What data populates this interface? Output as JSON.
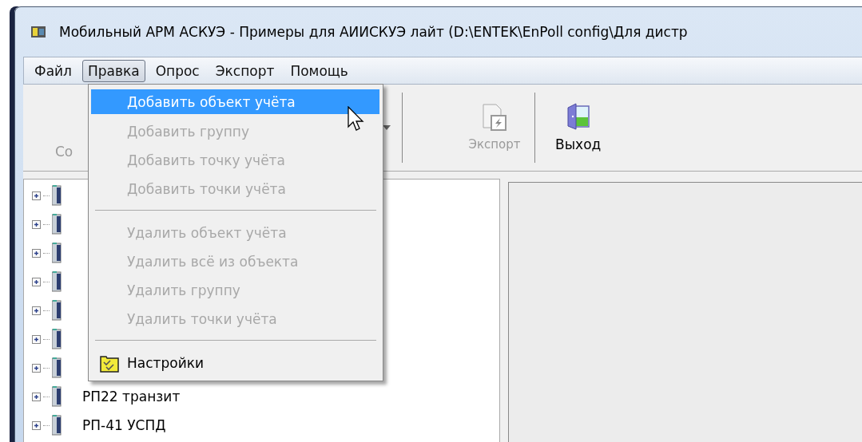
{
  "window": {
    "title": "Мобильный АРМ АСКУЭ - Примеры для АИИСКУЭ лайт (D:\\ENTEK\\EnPoll config\\Для дистр"
  },
  "menu_bar": [
    {
      "label": "Файл",
      "selected": false
    },
    {
      "label": "Правка",
      "selected": true
    },
    {
      "label": "Опрос",
      "selected": false
    },
    {
      "label": "Экспорт",
      "selected": false
    },
    {
      "label": "Помощь",
      "selected": false
    }
  ],
  "toolbar": [
    {
      "kind": "partial",
      "label": "Со",
      "disabled": true
    },
    {
      "kind": "dropdown"
    },
    {
      "kind": "separator"
    },
    {
      "kind": "export",
      "label": "Экспорт",
      "disabled": true
    },
    {
      "kind": "separator"
    },
    {
      "kind": "exit",
      "label": "Выход",
      "disabled": false
    }
  ],
  "tree": {
    "items": [
      {
        "expanded": false
      },
      {
        "expanded": false
      },
      {
        "expanded": false
      },
      {
        "expanded": false
      },
      {
        "expanded": false
      },
      {
        "expanded": false
      },
      {
        "expanded": false
      },
      {
        "label": "РП22 транзит",
        "expanded": false
      },
      {
        "label": "РП-41 УСПД",
        "expanded": false
      }
    ]
  },
  "edit_menu": [
    {
      "kind": "item",
      "label": "Добавить объект учёта",
      "disabled": false,
      "selected": true
    },
    {
      "kind": "item",
      "label": "Добавить группу",
      "disabled": true,
      "selected": false
    },
    {
      "kind": "item",
      "label": "Добавить точку учёта",
      "disabled": true,
      "selected": false
    },
    {
      "kind": "item",
      "label": "Добавить точки учёта",
      "disabled": true,
      "selected": false
    },
    {
      "kind": "separator"
    },
    {
      "kind": "item",
      "label": "Удалить объект учёта",
      "disabled": true,
      "selected": false
    },
    {
      "kind": "item",
      "label": "Удалить всё из объекта",
      "disabled": true,
      "selected": false
    },
    {
      "kind": "item",
      "label": "Удалить группу",
      "disabled": true,
      "selected": false
    },
    {
      "kind": "item",
      "label": "Удалить точки учёта",
      "disabled": true,
      "selected": false
    },
    {
      "kind": "separator"
    },
    {
      "kind": "settings",
      "label": "Настройки",
      "disabled": false,
      "selected": false
    }
  ]
}
